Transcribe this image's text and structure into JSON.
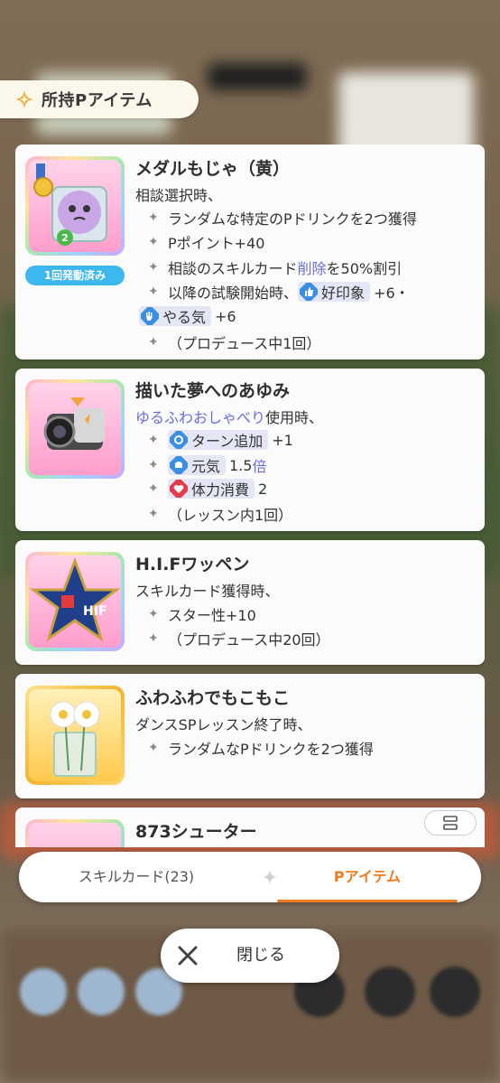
{
  "header": {
    "title": "所持Pアイテム",
    "icon": "sparkle-icon"
  },
  "items": [
    {
      "name": "メダルもじゃ（黄）",
      "badge": "1回発動済み",
      "condition": "相談選択時、",
      "effects": {
        "e1": "ランダムな特定のPドリンクを2つ獲得",
        "e2": "Pポイント+40",
        "e3a": "相談のスキルカード",
        "e3b": "削除",
        "e3c": "を50%割引",
        "e4a": "以降の試験開始時、",
        "e4b": "好印象",
        "e4c": "+6・",
        "e5a": "やる気",
        "e5b": "+6",
        "e6": "（プロデュース中1回）"
      },
      "icon_badge": "2"
    },
    {
      "name": "描いた夢へのあゆみ",
      "condition_highlight": "ゆるふわおしゃべり",
      "condition_rest": "使用時、",
      "effects": {
        "e1a": "ターン追加",
        "e1b": "+1",
        "e2a": "元気",
        "e2b": "1.5",
        "e2c": "倍",
        "e3a": "体力消費",
        "e3b": "2",
        "e4": "（レッスン内1回）"
      }
    },
    {
      "name": "H.I.Fワッペン",
      "condition": "スキルカード獲得時、",
      "effects": {
        "e1": "スター性+10",
        "e2": "（プロデュース中20回）"
      }
    },
    {
      "name": "ふわふわでもこもこ",
      "condition": "ダンスSPレッスン終了時、",
      "effects": {
        "e1": "ランダムなPドリンクを2つ獲得"
      }
    },
    {
      "name": "873シューター"
    }
  ],
  "tabs": {
    "skill": "スキルカード(23)",
    "pitem": "Pアイテム",
    "active": "pitem"
  },
  "close": {
    "label": "閉じる"
  },
  "colors": {
    "accent": "#f07b1f",
    "link": "#6b6bd9",
    "badge": "#3db8ef"
  }
}
